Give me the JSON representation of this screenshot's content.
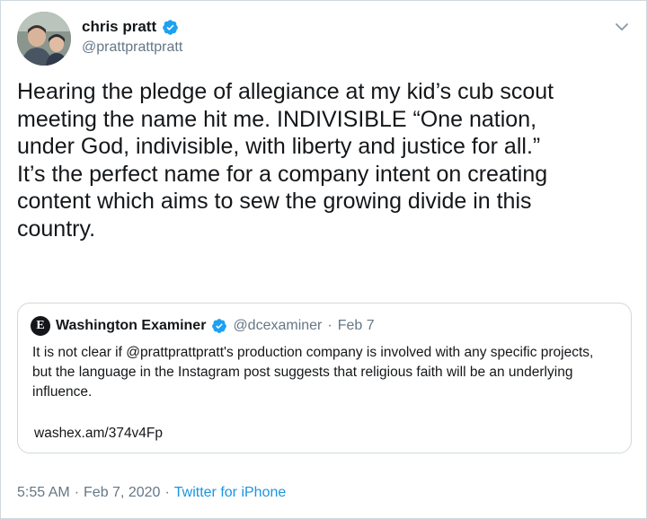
{
  "author": {
    "display_name": "chris pratt",
    "handle": "@prattprattpratt"
  },
  "tweet": {
    "text": "Hearing the pledge of allegiance at my kid’s cub scout\nmeeting the name hit me. INDIVISIBLE “One nation,\nunder God, indivisible, with liberty and justice for all.”\nIt’s the perfect name for a company intent on creating\ncontent which aims to sew the growing divide in this\ncountry.",
    "time": "5:55 AM",
    "sep1": "·",
    "date": "Feb 7, 2020",
    "sep2": "·",
    "source": "Twitter for iPhone"
  },
  "quote": {
    "logo_letter": "E",
    "display_name": "Washington Examiner",
    "handle": "@dcexaminer",
    "sep": "·",
    "date": "Feb 7",
    "text": "It is not clear if @prattprattpratt's production company is involved with any specific projects, but the language in the Instagram post suggests that religious faith will be an underlying influence.",
    "link": "washex.am/374v4Fp"
  },
  "colors": {
    "verified": "#1da1f2",
    "link": "#1b95e0",
    "secondary_text": "#657786"
  },
  "icons": {
    "verified": "verified-badge-icon",
    "menu": "chevron-down-icon"
  }
}
